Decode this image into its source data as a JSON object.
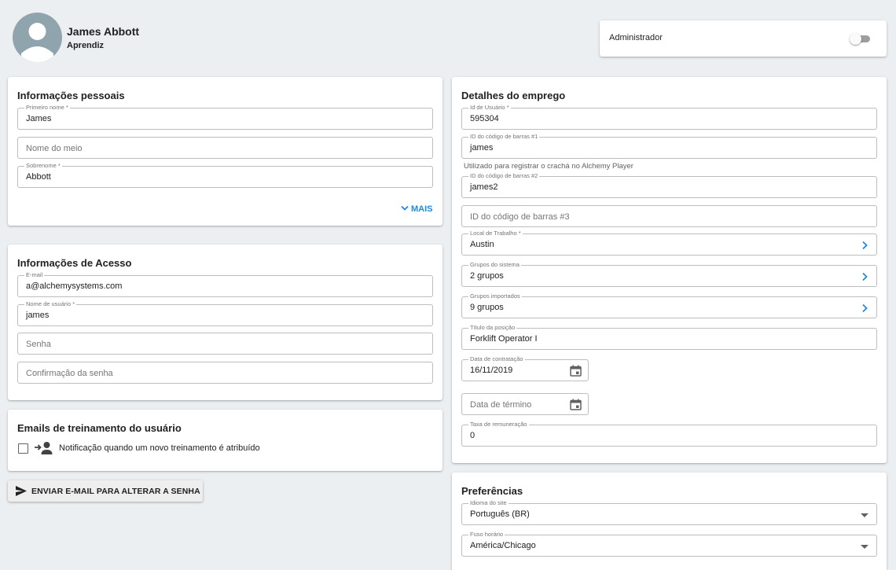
{
  "user": {
    "name": "James Abbott",
    "role": "Aprendiz"
  },
  "admin": {
    "label": "Administrador",
    "enabled": false
  },
  "personal": {
    "title": "Informações pessoais",
    "first_name": {
      "label": "Primeiro nome *",
      "value": "James"
    },
    "middle_name": {
      "placeholder": "Nome do meio"
    },
    "last_name": {
      "label": "Sobrenome *",
      "value": "Abbott"
    },
    "more_label": "MAIS"
  },
  "access": {
    "title": "Informações de Acesso",
    "email": {
      "label": "E-mail",
      "value": "a@alchemysystems.com"
    },
    "username": {
      "label": "Nome de usuário *",
      "value": "james"
    },
    "password": {
      "placeholder": "Senha"
    },
    "password_confirm": {
      "placeholder": "Confirmação da senha"
    }
  },
  "training_emails": {
    "title": "Emails de treinamento do usuário",
    "notify_label": "Notificação quando um novo treinamento é atribuído",
    "notify_checked": false
  },
  "send_reset_label": "ENVIAR E-MAIL PARA ALTERAR A SENHA",
  "employment": {
    "title": "Detalhes do emprego",
    "user_id": {
      "label": "Id de Usuário *",
      "value": "595304"
    },
    "barcode1": {
      "label": "ID do código de barras #1",
      "value": "james"
    },
    "barcode1_helper": "Utilizado para registrar o crachá no Alchemy Player",
    "barcode2": {
      "label": "ID do código de barras #2",
      "value": "james2"
    },
    "barcode3": {
      "placeholder": "ID do código de barras #3"
    },
    "workplace": {
      "label": "Local de Trabalho *",
      "value": "Austin"
    },
    "system_groups": {
      "label": "Grupos do sistema",
      "value": "2 grupos"
    },
    "imported_groups": {
      "label": "Grupos importados",
      "value": "9 grupos"
    },
    "position_title": {
      "label": "Título da posição",
      "value": "Forklift Operator I"
    },
    "hire_date": {
      "label": "Data de contratação",
      "value": "16/11/2019"
    },
    "end_date": {
      "placeholder": "Data de término"
    },
    "pay_rate": {
      "label": "Taxa de remuneração",
      "value": "0"
    }
  },
  "preferences": {
    "title": "Preferências",
    "language": {
      "label": "Idioma do site",
      "value": "Português (BR)"
    },
    "timezone": {
      "label": "Fuso horário",
      "value": "América/Chicago"
    }
  },
  "colors": {
    "accent": "#1e88e5",
    "background": "#eceff1",
    "avatar": "#90a4ae"
  }
}
